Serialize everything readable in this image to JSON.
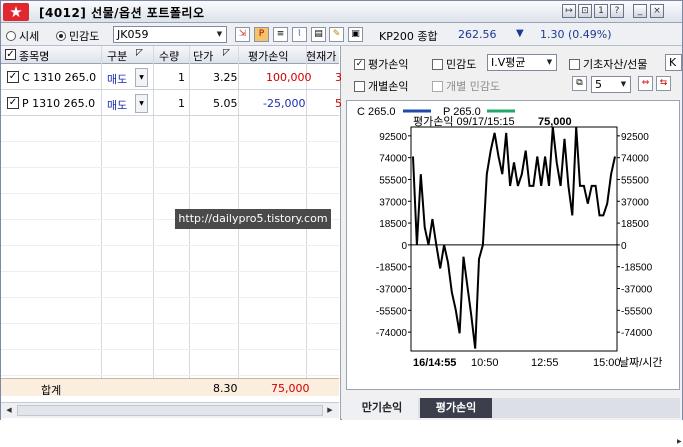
{
  "window": {
    "code": "[4012]",
    "title": "선물/옵션 포트폴리오",
    "buttons": [
      "↦",
      "⊡",
      "1",
      "?",
      "_",
      "×"
    ]
  },
  "toolbar": {
    "radio_price": "시세",
    "radio_sensitivity": "민감도",
    "code_value": "JK059",
    "index_label": "KP200 종합",
    "index_value": "262.56",
    "index_arrow": "▼",
    "index_change": "1.30 (0.49%)",
    "colors": {
      "down": "#1a3b94"
    }
  },
  "table": {
    "headers": [
      "종목명",
      "구분",
      "수량",
      "단가",
      "평가손익",
      "현재가"
    ],
    "rows": [
      {
        "name": "C 1310 265.0",
        "side": "매도",
        "qty": "1",
        "price": "3.25",
        "pnl": "100,000",
        "cur": "3"
      },
      {
        "name": "P 1310 265.0",
        "side": "매도",
        "qty": "1",
        "price": "5.05",
        "pnl": "-25,000",
        "cur": "5"
      }
    ],
    "sum": {
      "label": "합계",
      "price": "8.30",
      "pnl": "75,000"
    },
    "colors": {
      "profit": "#d00000",
      "loss": "#1a2fb0",
      "side": "#1a2fb0"
    }
  },
  "watermark": "http://dailypro5.tistory.com",
  "options": {
    "eval_pnl": "평가손익",
    "sensitivity": "민감도",
    "iv_select": "I.V평균",
    "base_asset": "기초자산/선물",
    "base_asset_field": "K",
    "individual_pnl": "개별손익",
    "individual_sensitivity": "개별 민감도",
    "count_select": "5"
  },
  "chart_data": {
    "type": "line",
    "legend": [
      {
        "name": "C 265.0",
        "color": "#1f4aa8"
      },
      {
        "name": "P 265.0",
        "color": "#1fa86a"
      }
    ],
    "header": {
      "label": "평가손익 09/17/15:15",
      "value": "75,000"
    },
    "yticks": [
      "92500",
      "74000",
      "55500",
      "37000",
      "18500",
      "0",
      "-18500",
      "-37000",
      "-55500",
      "-74000"
    ],
    "ytick_values": [
      92500,
      74000,
      55500,
      37000,
      18500,
      0,
      -18500,
      -37000,
      -55500,
      -74000
    ],
    "xticks": [
      "16/14:55",
      "10:50",
      "12:55",
      "15:00"
    ],
    "xlabel": "날짜/시간",
    "ylim": [
      -90000,
      100000
    ],
    "values": [
      75000,
      0,
      60000,
      15000,
      0,
      22000,
      0,
      -20000,
      0,
      -15000,
      -40000,
      -55000,
      -75000,
      -10000,
      -35000,
      -60000,
      -88000,
      -12000,
      0,
      60000,
      80000,
      95000,
      75000,
      60000,
      95000,
      50000,
      70000,
      50000,
      60000,
      80000,
      50000,
      50000,
      75000,
      50000,
      75000,
      50000,
      100000,
      70000,
      50000,
      90000,
      50000,
      25000,
      100000,
      50000,
      50000,
      35000,
      50000,
      50000,
      25000,
      25000,
      35000,
      60000,
      75000
    ]
  },
  "tabs": [
    "만기손익",
    "평가손익"
  ]
}
